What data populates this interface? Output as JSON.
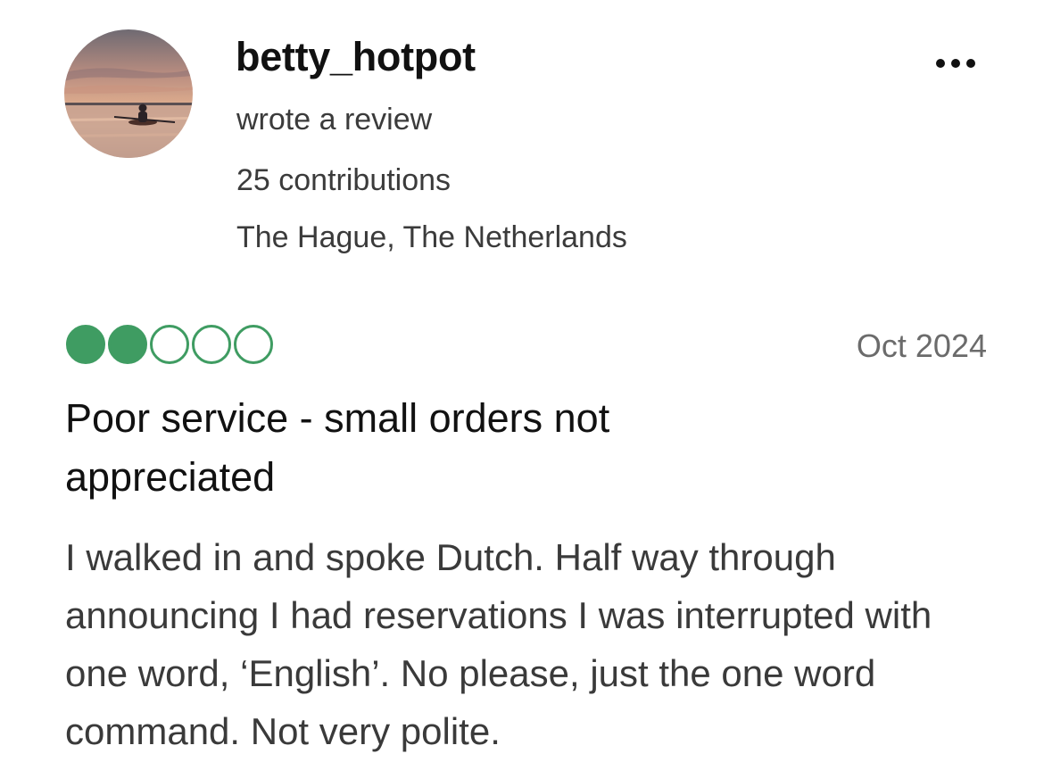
{
  "reviewer": {
    "username": "betty_hotpot",
    "action": "wrote a review",
    "contributions": "25 contributions",
    "location": "The Hague, The Netherlands",
    "avatar_icon": "sunset-kayak-avatar"
  },
  "menu": {
    "icon": "more-options-icon"
  },
  "review": {
    "rating": 2,
    "rating_max": 5,
    "rating_color": "#3f9c62",
    "date": "Oct 2024",
    "title": "Poor service - small orders not appreciated",
    "body": "I walked in and spoke Dutch. Half way through announcing I had reservations I was interrupted with one word, ‘English’. No please, just the one word command. Not very polite."
  }
}
